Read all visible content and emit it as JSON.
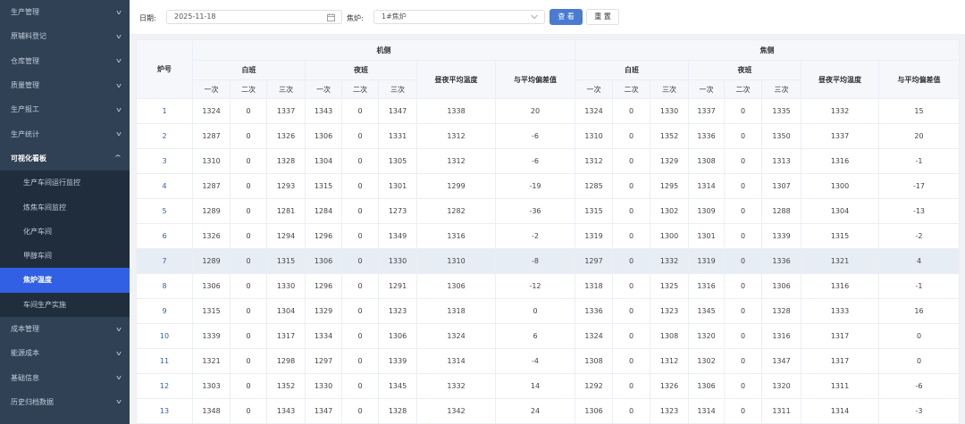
{
  "sidebar": {
    "items_top": [
      {
        "label": "生产管理"
      },
      {
        "label": "原辅料登记"
      },
      {
        "label": "仓库管理"
      },
      {
        "label": "质量管理"
      },
      {
        "label": "生产报工"
      },
      {
        "label": "生产统计"
      }
    ],
    "open_item": {
      "label": "可视化看板"
    },
    "sub_items": [
      {
        "label": "生产车间运行监控"
      },
      {
        "label": "炼焦车间监控"
      },
      {
        "label": "化产车间"
      },
      {
        "label": "甲醇车间"
      },
      {
        "label": "焦炉温度"
      },
      {
        "label": "车间生产实施"
      }
    ],
    "active_sub_index": 4,
    "items_bottom": [
      {
        "label": "成本管理"
      },
      {
        "label": "能源成本"
      },
      {
        "label": "基础信息"
      },
      {
        "label": "历史归档数据"
      }
    ]
  },
  "toolbar": {
    "date_label": "日期:",
    "date_value": "2025-11-18",
    "furnace_label": "焦炉:",
    "furnace_value": "1#焦炉",
    "query_label": "查 看",
    "reset_label": "重 置"
  },
  "table": {
    "headers": {
      "furnace_no": "炉号",
      "machine_side": "机侧",
      "coke_side": "焦侧",
      "day_shift": "白班",
      "night_shift": "夜班",
      "avg_temp": "昼夜平均温度",
      "deviation": "与平均偏差值",
      "first": "一次",
      "second": "二次",
      "third": "三次"
    },
    "rows": [
      [
        "1",
        "1324",
        "0",
        "1337",
        "1343",
        "0",
        "1347",
        "1338",
        "20",
        "1324",
        "0",
        "1330",
        "1337",
        "0",
        "1335",
        "1332",
        "15"
      ],
      [
        "2",
        "1287",
        "0",
        "1326",
        "1306",
        "0",
        "1331",
        "1312",
        "-6",
        "1310",
        "0",
        "1352",
        "1336",
        "0",
        "1350",
        "1337",
        "20"
      ],
      [
        "3",
        "1310",
        "0",
        "1328",
        "1304",
        "0",
        "1305",
        "1312",
        "-6",
        "1312",
        "0",
        "1329",
        "1308",
        "0",
        "1313",
        "1316",
        "-1"
      ],
      [
        "4",
        "1287",
        "0",
        "1293",
        "1315",
        "0",
        "1301",
        "1299",
        "-19",
        "1285",
        "0",
        "1295",
        "1314",
        "0",
        "1307",
        "1300",
        "-17"
      ],
      [
        "5",
        "1289",
        "0",
        "1281",
        "1284",
        "0",
        "1273",
        "1282",
        "-36",
        "1315",
        "0",
        "1302",
        "1309",
        "0",
        "1288",
        "1304",
        "-13"
      ],
      [
        "6",
        "1326",
        "0",
        "1294",
        "1296",
        "0",
        "1349",
        "1316",
        "-2",
        "1319",
        "0",
        "1300",
        "1301",
        "0",
        "1339",
        "1315",
        "-2"
      ],
      [
        "7",
        "1289",
        "0",
        "1315",
        "1306",
        "0",
        "1330",
        "1310",
        "-8",
        "1297",
        "0",
        "1332",
        "1319",
        "0",
        "1336",
        "1321",
        "4"
      ],
      [
        "8",
        "1306",
        "0",
        "1330",
        "1296",
        "0",
        "1291",
        "1306",
        "-12",
        "1318",
        "0",
        "1325",
        "1316",
        "0",
        "1306",
        "1316",
        "-1"
      ],
      [
        "9",
        "1315",
        "0",
        "1304",
        "1329",
        "0",
        "1323",
        "1318",
        "0",
        "1336",
        "0",
        "1323",
        "1345",
        "0",
        "1328",
        "1333",
        "16"
      ],
      [
        "10",
        "1339",
        "0",
        "1317",
        "1334",
        "0",
        "1306",
        "1324",
        "6",
        "1324",
        "0",
        "1308",
        "1320",
        "0",
        "1316",
        "1317",
        "0"
      ],
      [
        "11",
        "1321",
        "0",
        "1298",
        "1297",
        "0",
        "1339",
        "1314",
        "-4",
        "1308",
        "0",
        "1312",
        "1302",
        "0",
        "1347",
        "1317",
        "0"
      ],
      [
        "12",
        "1303",
        "0",
        "1352",
        "1330",
        "0",
        "1345",
        "1332",
        "14",
        "1292",
        "0",
        "1326",
        "1306",
        "0",
        "1320",
        "1311",
        "-6"
      ],
      [
        "13",
        "1348",
        "0",
        "1343",
        "1347",
        "0",
        "1328",
        "1342",
        "24",
        "1306",
        "0",
        "1323",
        "1314",
        "0",
        "1311",
        "1314",
        "-3"
      ]
    ],
    "highlight_row_index": 6
  }
}
